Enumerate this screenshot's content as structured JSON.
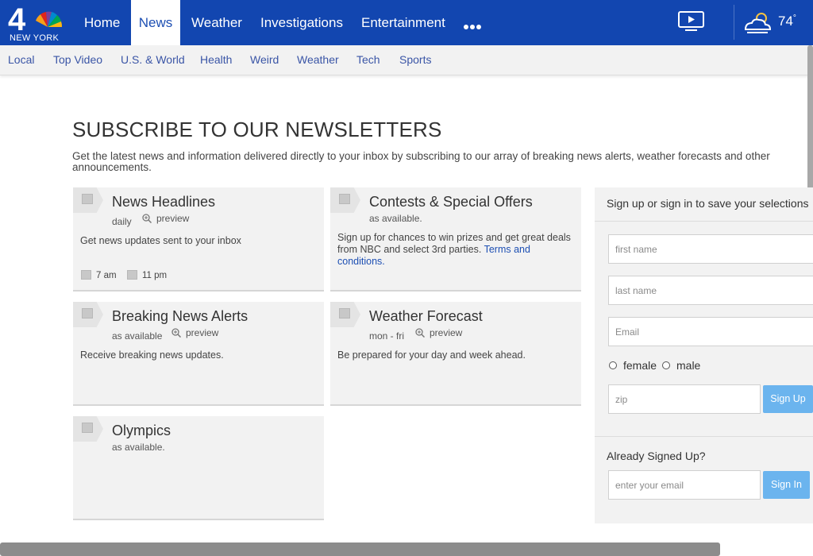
{
  "header": {
    "logo_channel": "4",
    "logo_city": "NEW YORK",
    "nav": [
      {
        "label": "Home",
        "active": false
      },
      {
        "label": "News",
        "active": true
      },
      {
        "label": "Weather",
        "active": false
      },
      {
        "label": "Investigations",
        "active": false
      },
      {
        "label": "Entertainment",
        "active": false
      }
    ],
    "more_icon": "ellipsis-icon",
    "video_icon": "tv-play-icon",
    "weather_icon": "partly-cloudy-sun-icon",
    "temperature": "74",
    "temperature_unit": "°"
  },
  "subnav": [
    "Local",
    "Top Video",
    "U.S. & World",
    "Health",
    "Weird",
    "Weather",
    "Tech",
    "Sports"
  ],
  "page": {
    "title": "SUBSCRIBE TO OUR NEWSLETTERS",
    "intro": "Get the latest news and information delivered directly to your inbox by subscribing to our array of breaking news alerts, weather forecasts and other announcements."
  },
  "newsletters": [
    {
      "title": "News Headlines",
      "frequency": "daily",
      "preview": "preview",
      "description": "Get news updates sent to your inbox",
      "times": [
        "7 am",
        "11 pm"
      ]
    },
    {
      "title": "Contests & Special Offers",
      "frequency": "as available.",
      "description": "Sign up for chances to win prizes and get great deals from NBC and select 3rd parties. ",
      "link": "Terms and conditions."
    },
    {
      "title": "Breaking News Alerts",
      "frequency": "as available",
      "preview": "preview",
      "description": "Receive breaking news updates."
    },
    {
      "title": "Weather Forecast",
      "frequency": "mon - fri",
      "preview": "preview",
      "description": "Be prepared for your day and week ahead."
    },
    {
      "title": "Olympics",
      "frequency": "as available."
    }
  ],
  "signup": {
    "heading": "Sign up or sign in to save your selections",
    "first_name_placeholder": "first name",
    "last_name_placeholder": "last name",
    "email_placeholder": "Email",
    "gender_options": [
      "female",
      "male"
    ],
    "zip_placeholder": "zip",
    "signup_button": "Sign Up",
    "already_label": "Already Signed Up?",
    "signin_email_placeholder": "enter your email",
    "signin_button": "Sign In"
  },
  "colors": {
    "brand_blue": "#1246b0",
    "link_blue": "#3a55a6",
    "button_blue": "#6bb4ee"
  }
}
